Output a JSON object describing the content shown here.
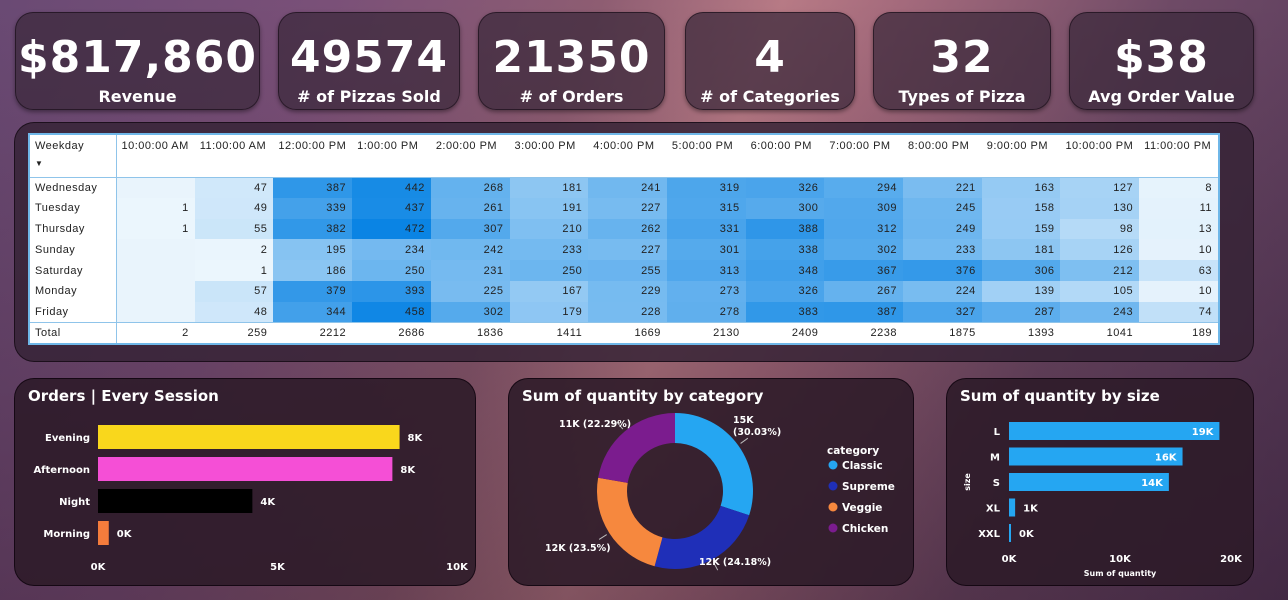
{
  "kpis": [
    {
      "value": "$817,860",
      "label": "Revenue"
    },
    {
      "value": "49574",
      "label": "# of Pizzas Sold"
    },
    {
      "value": "21350",
      "label": "# of Orders"
    },
    {
      "value": "4",
      "label": "# of Categories"
    },
    {
      "value": "32",
      "label": "Types of Pizza"
    },
    {
      "value": "$38",
      "label": "Avg Order Value"
    }
  ],
  "matrix": {
    "corner_header": "Weekday",
    "columns": [
      "10:00:00 AM",
      "11:00:00 AM",
      "12:00:00 PM",
      "1:00:00 PM",
      "2:00:00 PM",
      "3:00:00 PM",
      "4:00:00 PM",
      "5:00:00 PM",
      "6:00:00 PM",
      "7:00:00 PM",
      "8:00:00 PM",
      "9:00:00 PM",
      "10:00:00 PM",
      "11:00:00 PM"
    ],
    "rows": [
      {
        "day": "Wednesday",
        "values": [
          null,
          47,
          387,
          442,
          268,
          181,
          241,
          319,
          326,
          294,
          221,
          163,
          127,
          8
        ]
      },
      {
        "day": "Tuesday",
        "values": [
          1,
          49,
          339,
          437,
          261,
          191,
          227,
          315,
          300,
          309,
          245,
          158,
          130,
          11
        ]
      },
      {
        "day": "Thursday",
        "values": [
          1,
          55,
          382,
          472,
          307,
          210,
          262,
          331,
          388,
          312,
          249,
          159,
          98,
          13
        ]
      },
      {
        "day": "Sunday",
        "values": [
          null,
          2,
          195,
          234,
          242,
          233,
          227,
          301,
          338,
          302,
          233,
          181,
          126,
          10
        ]
      },
      {
        "day": "Saturday",
        "values": [
          null,
          1,
          186,
          250,
          231,
          250,
          255,
          313,
          348,
          367,
          376,
          306,
          212,
          63
        ]
      },
      {
        "day": "Monday",
        "values": [
          null,
          57,
          379,
          393,
          225,
          167,
          229,
          273,
          326,
          267,
          224,
          139,
          105,
          10
        ]
      },
      {
        "day": "Friday",
        "values": [
          null,
          48,
          344,
          458,
          302,
          179,
          228,
          278,
          383,
          387,
          327,
          287,
          243,
          74
        ]
      }
    ],
    "total": {
      "day": "Total",
      "values": [
        2,
        259,
        2212,
        2686,
        1836,
        1411,
        1669,
        2130,
        2409,
        2238,
        1875,
        1393,
        1041,
        189
      ]
    }
  },
  "chart_data": [
    {
      "type": "bar",
      "title": "Orders | Every Session",
      "orientation": "horizontal",
      "categories": [
        "Evening",
        "Afternoon",
        "Night",
        "Morning"
      ],
      "values": [
        8400,
        8200,
        4300,
        300
      ],
      "data_labels": [
        "8K",
        "8K",
        "4K",
        "0K"
      ],
      "colors": [
        "#f9d71c",
        "#f54fd6",
        "#000000",
        "#f47c3c"
      ],
      "xlim": [
        0,
        10000
      ],
      "x_ticks": [
        "0K",
        "5K",
        "10K"
      ]
    },
    {
      "type": "pie",
      "title": "Sum of quantity by category",
      "legend_title": "category",
      "legend_position": "right",
      "categories": [
        "Classic",
        "Supreme",
        "Veggie",
        "Chicken"
      ],
      "values": [
        14888,
        11987,
        11649,
        11050
      ],
      "data_labels": [
        "15K\n(30.03%)",
        "12K (24.18%)",
        "12K (23.5%)",
        "11K (22.29%)"
      ],
      "colors": [
        "#25a6f2",
        "#1f2fb8",
        "#f6883e",
        "#7b1c8e"
      ]
    },
    {
      "type": "bar",
      "title": "Sum of quantity by size",
      "orientation": "horizontal",
      "categories": [
        "L",
        "M",
        "S",
        "XL",
        "XXL"
      ],
      "values": [
        18956,
        15635,
        14403,
        552,
        28
      ],
      "data_labels": [
        "19K",
        "16K",
        "14K",
        "1K",
        "0K"
      ],
      "color": "#25a6f2",
      "xlabel": "Sum of quantity",
      "ylabel": "size",
      "xlim": [
        0,
        20000
      ],
      "x_ticks": [
        "0K",
        "10K",
        "20K"
      ]
    }
  ]
}
